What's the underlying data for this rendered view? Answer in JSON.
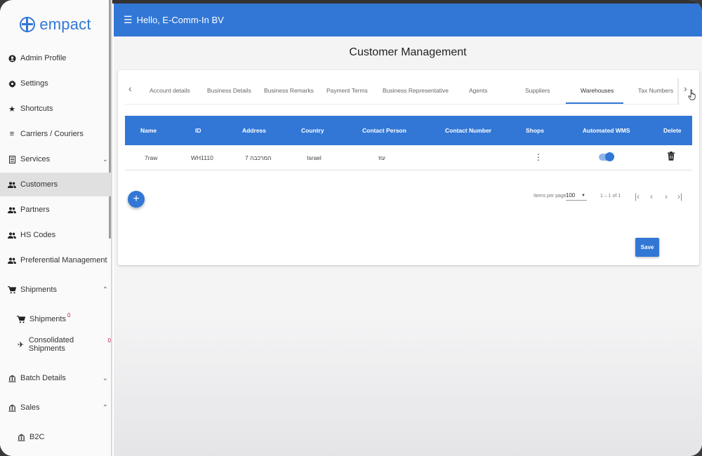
{
  "brand": {
    "logo_text": "empact",
    "accent": "#3277d6"
  },
  "header": {
    "greeting": "Hello, E-Comm-In BV"
  },
  "sidebar": {
    "items": [
      {
        "label": "Admin Profile",
        "icon": "account-icon"
      },
      {
        "label": "Settings",
        "icon": "gear-icon"
      },
      {
        "label": "Shortcuts",
        "icon": "star-icon"
      },
      {
        "label": "Carriers / Couriers",
        "icon": "list-icon"
      },
      {
        "label": "Services",
        "icon": "document-icon",
        "chevron": "down"
      },
      {
        "label": "Customers",
        "icon": "people-icon",
        "active": true
      },
      {
        "label": "Partners",
        "icon": "people-icon"
      },
      {
        "label": "HS Codes",
        "icon": "people-icon"
      },
      {
        "label": "Preferential Management",
        "icon": "people-icon"
      },
      {
        "label": "Shipments",
        "icon": "cart-icon",
        "chevron": "up"
      },
      {
        "label": "Shipments",
        "icon": "cart-icon",
        "sub": true,
        "badge": "0"
      },
      {
        "label": "Consolidated Shipments",
        "icon": "airplane-icon",
        "sub": true,
        "badge": "0"
      },
      {
        "label": "Batch Details",
        "icon": "bank-icon",
        "chevron": "down"
      },
      {
        "label": "Sales",
        "icon": "bank-icon",
        "chevron": "up"
      },
      {
        "label": "B2C",
        "icon": "bank-icon",
        "sub": true
      }
    ]
  },
  "main": {
    "title": "Customer Management",
    "tabs": [
      "Account details",
      "Business Details",
      "Business Remarks",
      "Payment Terms",
      "Business Representative",
      "Agents",
      "Suppliers",
      "Warehouses",
      "Tax Numbers"
    ],
    "active_tab": "Warehouses",
    "table": {
      "columns": [
        "Name",
        "ID",
        "Address",
        "Country",
        "Contact Person",
        "Contact Number",
        "Shops",
        "Automated WMS",
        "Delete"
      ],
      "rows": [
        {
          "name": "7raw",
          "id": "WH1110",
          "address": "המרכבה 7",
          "country": "Israel",
          "contact_person": "עוז",
          "contact_number": "",
          "automated_wms": true
        }
      ]
    },
    "pagination": {
      "items_per_page_label": "Items per page:",
      "items_per_page": "100",
      "range": "1 – 1 of 1"
    },
    "save_label": "Save"
  }
}
